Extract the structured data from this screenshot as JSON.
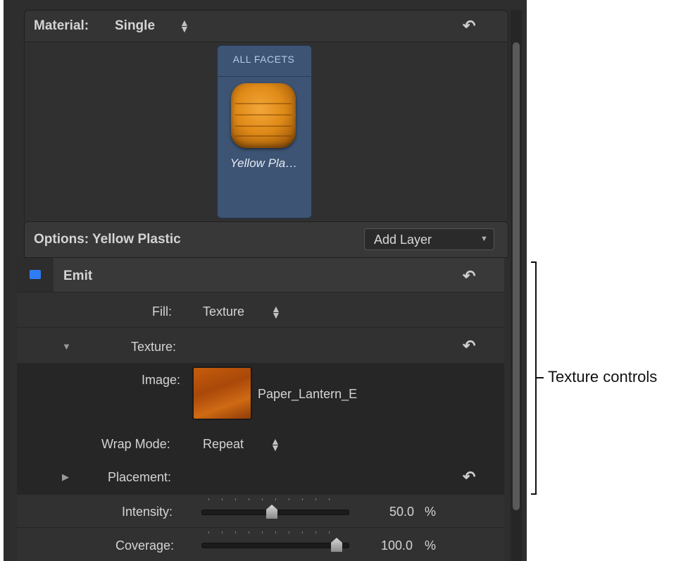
{
  "material": {
    "label": "Material:",
    "value": "Single"
  },
  "facets": {
    "title": "ALL FACETS",
    "item_name": "Yellow Pla…"
  },
  "options": {
    "label": "Options: Yellow Plastic",
    "add_layer": "Add Layer"
  },
  "emit": {
    "label": "Emit",
    "checkbox_color": "#2f7df6"
  },
  "fill": {
    "label": "Fill:",
    "value": "Texture"
  },
  "texture": {
    "label": "Texture:"
  },
  "image": {
    "label": "Image:",
    "file": "Paper_Lantern_E"
  },
  "wrap_mode": {
    "label": "Wrap Mode:",
    "value": "Repeat"
  },
  "placement": {
    "label": "Placement:"
  },
  "intensity": {
    "label": "Intensity:",
    "value": "50.0",
    "unit": "%",
    "fraction": 0.5
  },
  "coverage": {
    "label": "Coverage:",
    "value": "100.0",
    "unit": "%",
    "fraction": 1.0
  },
  "annotation": {
    "text": "Texture controls"
  }
}
